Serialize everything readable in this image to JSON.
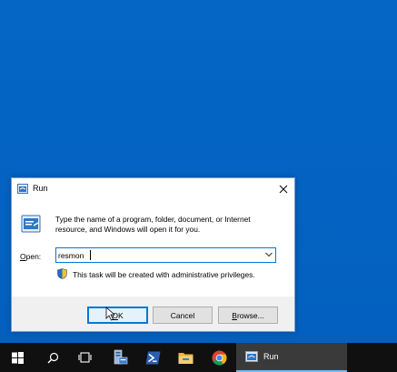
{
  "dialog": {
    "title": "Run",
    "description": "Type the name of a program, folder, document, or Internet resource, and Windows will open it for you.",
    "open_label_accel": "O",
    "open_label_rest": "pen:",
    "command_value": "resmon",
    "admin_note": "This task will be created with administrative privileges.",
    "ok_label": "OK",
    "ok_accel": "O",
    "ok_rest": "K",
    "cancel_label": "Cancel",
    "browse_accel": "B",
    "browse_rest": "rowse..."
  },
  "taskbar": {
    "items": [
      {
        "icon": "windows-start-icon"
      },
      {
        "icon": "search-icon"
      },
      {
        "icon": "task-view-icon"
      },
      {
        "icon": "server-manager-icon"
      },
      {
        "icon": "powershell-icon"
      },
      {
        "icon": "file-explorer-icon"
      },
      {
        "icon": "chrome-icon"
      }
    ],
    "active_window_label": "Run"
  },
  "colors": {
    "desktop": "#0263c4",
    "taskbar": "#101010",
    "accent": "#0078d7"
  }
}
